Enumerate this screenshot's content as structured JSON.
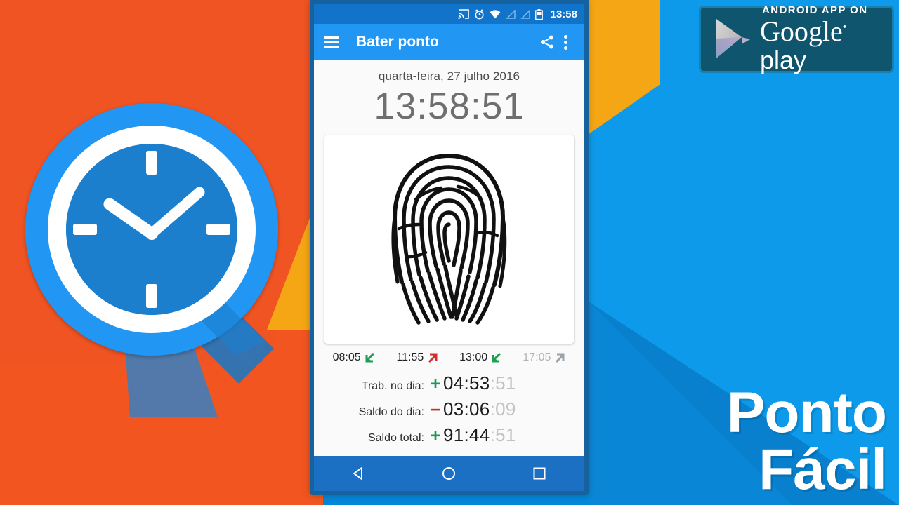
{
  "background": {
    "orange": "#F2551F",
    "amber": "#F5A614",
    "blue": "#0E9AEA",
    "blue_dark": "#0880CE"
  },
  "logo": {
    "name": "ponto-facil-clock-logo",
    "circle_color": "#2196F3",
    "face_color": "#1976C7",
    "hands_color": "#FFFFFF",
    "hour_hand": "10",
    "minute_hand": "10"
  },
  "play_badge": {
    "small_text": "ANDROID APP ON",
    "brand": "Google",
    "brand_suffix": "play",
    "bg_color": "#10556E",
    "border_color": "#1B7FAE"
  },
  "wordmark": {
    "line1": "Ponto",
    "line2": "Fácil"
  },
  "phone": {
    "statusbar": {
      "icons": [
        "cast-icon",
        "alarm-icon",
        "wifi-icon",
        "signal-icon",
        "signal-icon",
        "battery-icon"
      ],
      "time": "13:58",
      "bg_color": "#1273CB"
    },
    "toolbar": {
      "menu_icon": "hamburger-icon",
      "title": "Bater ponto",
      "share_icon": "share-icon",
      "overflow_icon": "overflow-menu-icon",
      "bg_color": "#2196F3"
    },
    "main": {
      "date": "quarta-feira, 27 julho 2016",
      "clock": "13:58:51",
      "fingerprint_label": "fingerprint-punch-button",
      "punches": [
        {
          "time": "08:05",
          "direction": "in",
          "arrow": "arrow-down-left-icon",
          "color": "#1CA04D",
          "pending": false
        },
        {
          "time": "11:55",
          "direction": "out",
          "arrow": "arrow-up-right-icon",
          "color": "#D32F2F",
          "pending": false
        },
        {
          "time": "13:00",
          "direction": "in",
          "arrow": "arrow-down-left-icon",
          "color": "#1CA04D",
          "pending": false
        },
        {
          "time": "17:05",
          "direction": "out",
          "arrow": "arrow-up-right-icon",
          "color": "#B0B0B0",
          "pending": true
        }
      ],
      "summary": [
        {
          "label": "Trab. no dia:",
          "sign": "+",
          "sign_type": "pos",
          "value": "04:53",
          "seconds": ":51"
        },
        {
          "label": "Saldo do dia:",
          "sign": "−",
          "sign_type": "neg",
          "value": "03:06",
          "seconds": ":09"
        },
        {
          "label": "Saldo total:",
          "sign": "+",
          "sign_type": "pos",
          "value": "91:44",
          "seconds": ":51"
        }
      ]
    },
    "navbar": {
      "back": "back-triangle-icon",
      "home": "home-circle-icon",
      "recents": "recents-square-icon",
      "bg_color": "#1C70C4"
    }
  }
}
